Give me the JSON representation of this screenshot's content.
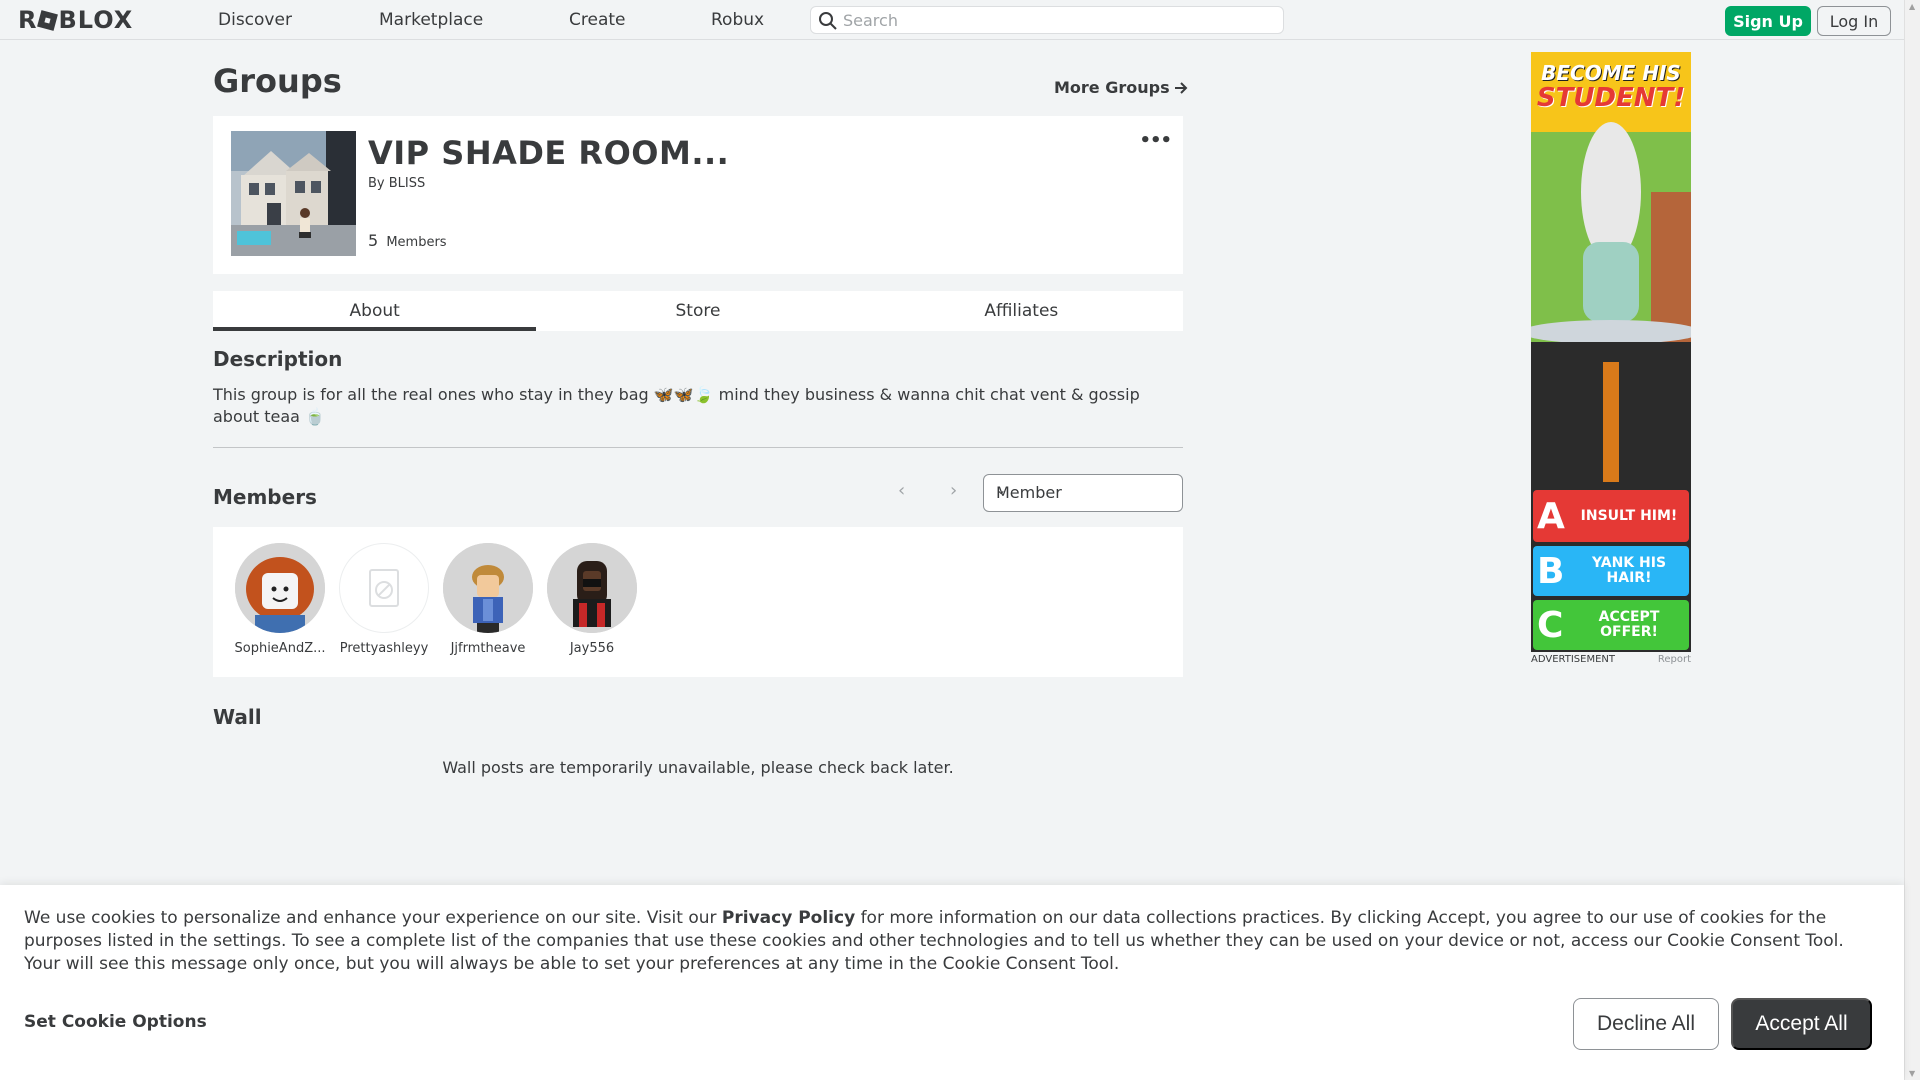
{
  "nav": {
    "logo": "ROBLOX",
    "links": [
      "Discover",
      "Marketplace",
      "Create",
      "Robux"
    ],
    "search_placeholder": "Search",
    "sign_up": "Sign Up",
    "log_in": "Log In"
  },
  "page": {
    "title": "Groups",
    "more_groups": "More Groups"
  },
  "group": {
    "name": "VIP SHADE ROOM...",
    "by_label": "By",
    "owner": "BLISS",
    "member_count": "5",
    "members_label": "Members"
  },
  "tabs": [
    "About",
    "Store",
    "Affiliates"
  ],
  "active_tab": "About",
  "description": {
    "title": "Description",
    "text": "This group is for all the real ones who stay in they bag 🦋🦋🍃 mind they business & wanna chit chat vent & gossip about teaa 🍵"
  },
  "members": {
    "title": "Members",
    "role_select": "Member",
    "list": [
      {
        "username": "SophieAndZ..."
      },
      {
        "username": "Prettyashleyy"
      },
      {
        "username": "Jjfrmtheave"
      },
      {
        "username": "Jay556"
      }
    ]
  },
  "wall": {
    "title": "Wall",
    "message": "Wall posts are temporarily unavailable, please check back later."
  },
  "ad": {
    "headline_1": "BECOME HIS",
    "headline_2": "STUDENT!",
    "options": [
      {
        "letter": "A",
        "text": "INSULT HIM!",
        "color": "#e53935"
      },
      {
        "letter": "B",
        "text": "YANK HIS HAIR!",
        "color": "#29b6f6"
      },
      {
        "letter": "C",
        "text": "ACCEPT OFFER!",
        "color": "#43c63a"
      }
    ],
    "label": "ADVERTISEMENT",
    "report": "Report"
  },
  "cookie": {
    "text_before": "We use cookies to personalize and enhance your experience on our site. Visit our ",
    "link": "Privacy Policy",
    "text_after": " for more information on our data collections practices. By clicking Accept, you agree to our use of cookies for the purposes listed in the settings. To see a complete list of the companies that use these cookies and other technologies and to tell us whether they can be used on your device or not, access our Cookie Consent Tool. Your will see this message only once, but you will always be able to set your preferences at any time in the Cookie Consent Tool.",
    "options": "Set Cookie Options",
    "decline": "Decline All",
    "accept": "Accept All"
  },
  "colors": {
    "background": "#f2f4f5",
    "text": "#393b3d",
    "sign_up": "#00a765",
    "accept": "#393b3d"
  }
}
